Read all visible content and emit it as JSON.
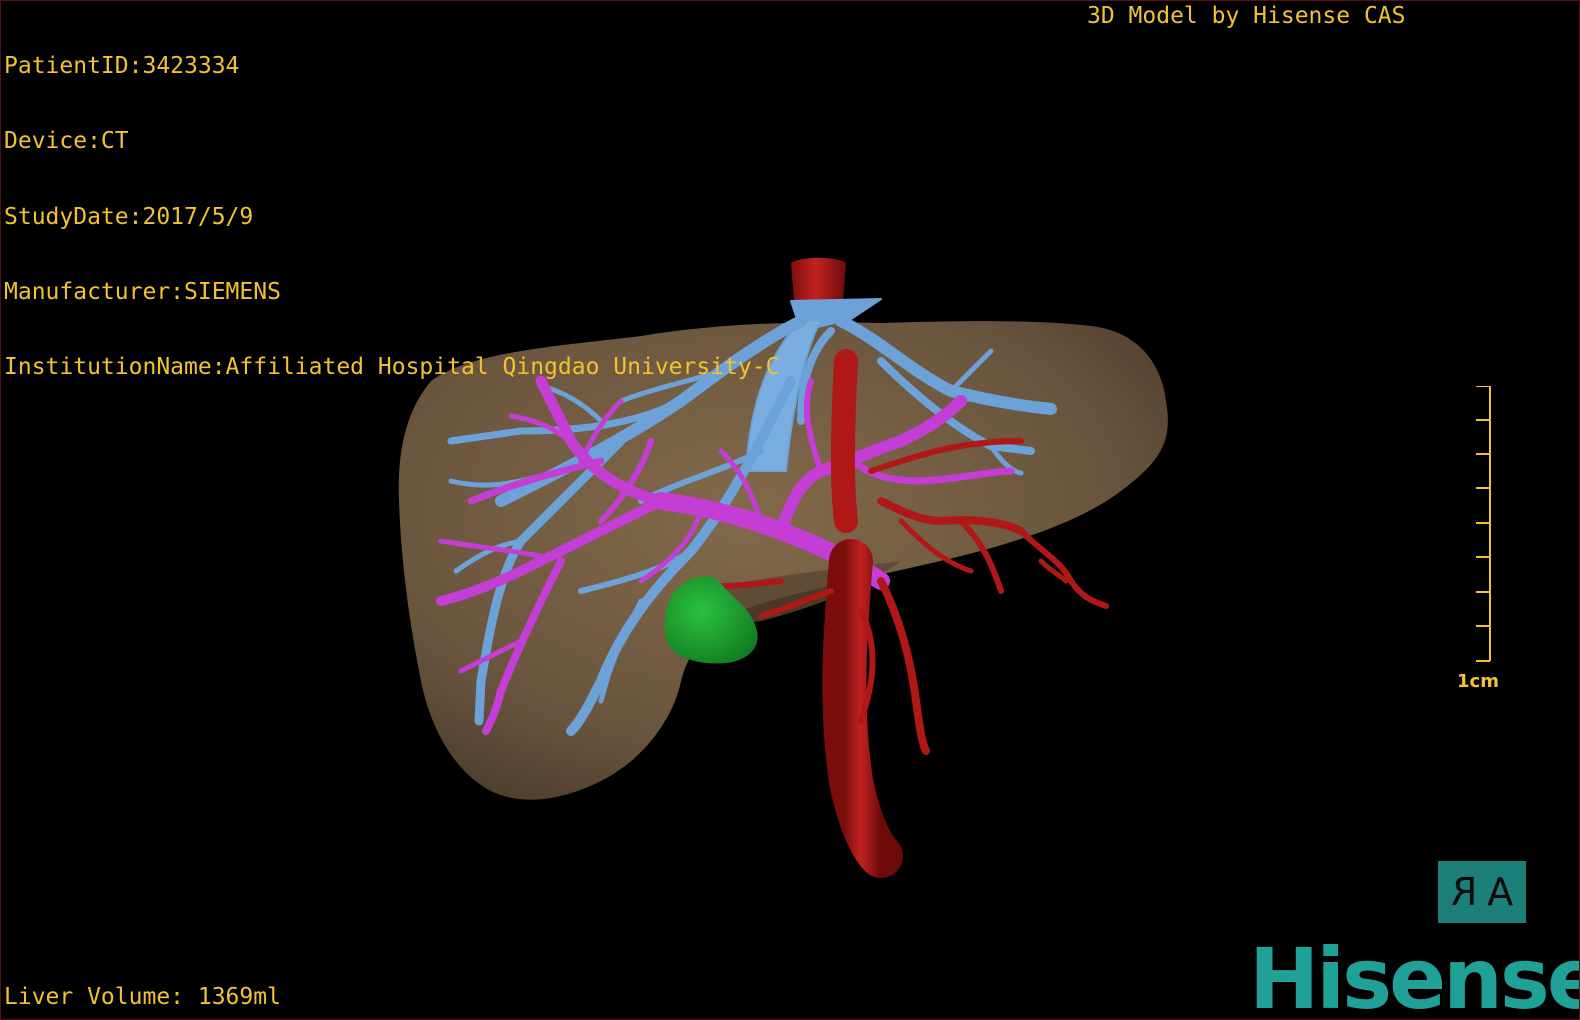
{
  "header": {
    "patient_id": "PatientID:3423334",
    "device": "Device:CT",
    "study_date": "StudyDate:2017/5/9",
    "manufacturer": "Manufacturer:SIEMENS",
    "institution": "InstitutionName:Affiliated Hospital Qingdao University-C"
  },
  "credit": "3D Model by Hisense CAS",
  "footer": {
    "liver_volume": "Liver Volume: 1369ml"
  },
  "scale": {
    "label": "1cm"
  },
  "orientation_button": {
    "left_glyph": "R",
    "right_glyph": "A"
  },
  "brand": {
    "name": "Hisense"
  },
  "colors": {
    "overlay_text": "#f2c233",
    "liver": "#7a6347",
    "hepatic_vein": "#6da2d8",
    "portal_vein": "#c43ed6",
    "artery": "#b01818",
    "gallbladder": "#1fa531",
    "brand": "#20a197"
  }
}
